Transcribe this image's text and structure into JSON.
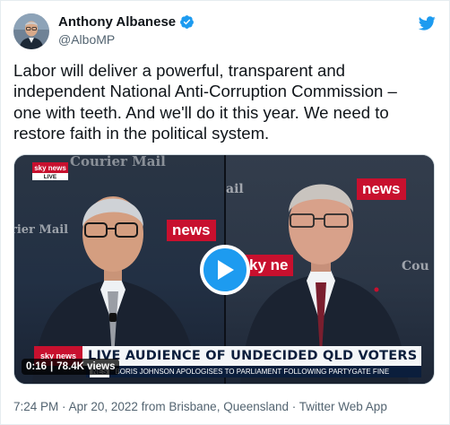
{
  "author": {
    "name": "Anthony Albanese",
    "handle": "@AlboMP",
    "verified": true,
    "avatar_icon": "profile-photo"
  },
  "tweet": {
    "text": "Labor will deliver a powerful, transparent and\nindependent National Anti-Corruption Commission –\none with teeth. And we'll do it this year. We need to\nrestore faith in the political system."
  },
  "video": {
    "elapsed": "0:16",
    "views": "78.4K views",
    "separator": "|",
    "backdrop": {
      "courier_mail_top": "Courier Mail",
      "courier_mail_left": "rier Mail",
      "courier_mail_right": "Cou",
      "fragment_ail": "ail",
      "sky_news_left": "news",
      "sky_news_mid": "ky ne",
      "sky_news_right": "news"
    },
    "sky_logo": {
      "top": "sky news",
      "bottom": "LIVE"
    },
    "lower_third": {
      "logo": "sky news",
      "headline": "LIVE AUDIENCE OF UNDECIDED QLD VOTERS",
      "ticker_tag": "NES",
      "ticker_text": "BORIS JOHNSON APOLOGISES TO PARLIAMENT FOLLOWING PARTYGATE FINE"
    }
  },
  "footer": {
    "time": "7:24 PM",
    "date": "Apr 20, 2022",
    "from": "from",
    "location": "Brisbane, Queensland",
    "dot": "·",
    "source": "Twitter Web App"
  },
  "colors": {
    "verified": "#1d9bf0",
    "play": "#1d9bf0",
    "sky_red": "#c8102e",
    "muted": "#536471"
  }
}
